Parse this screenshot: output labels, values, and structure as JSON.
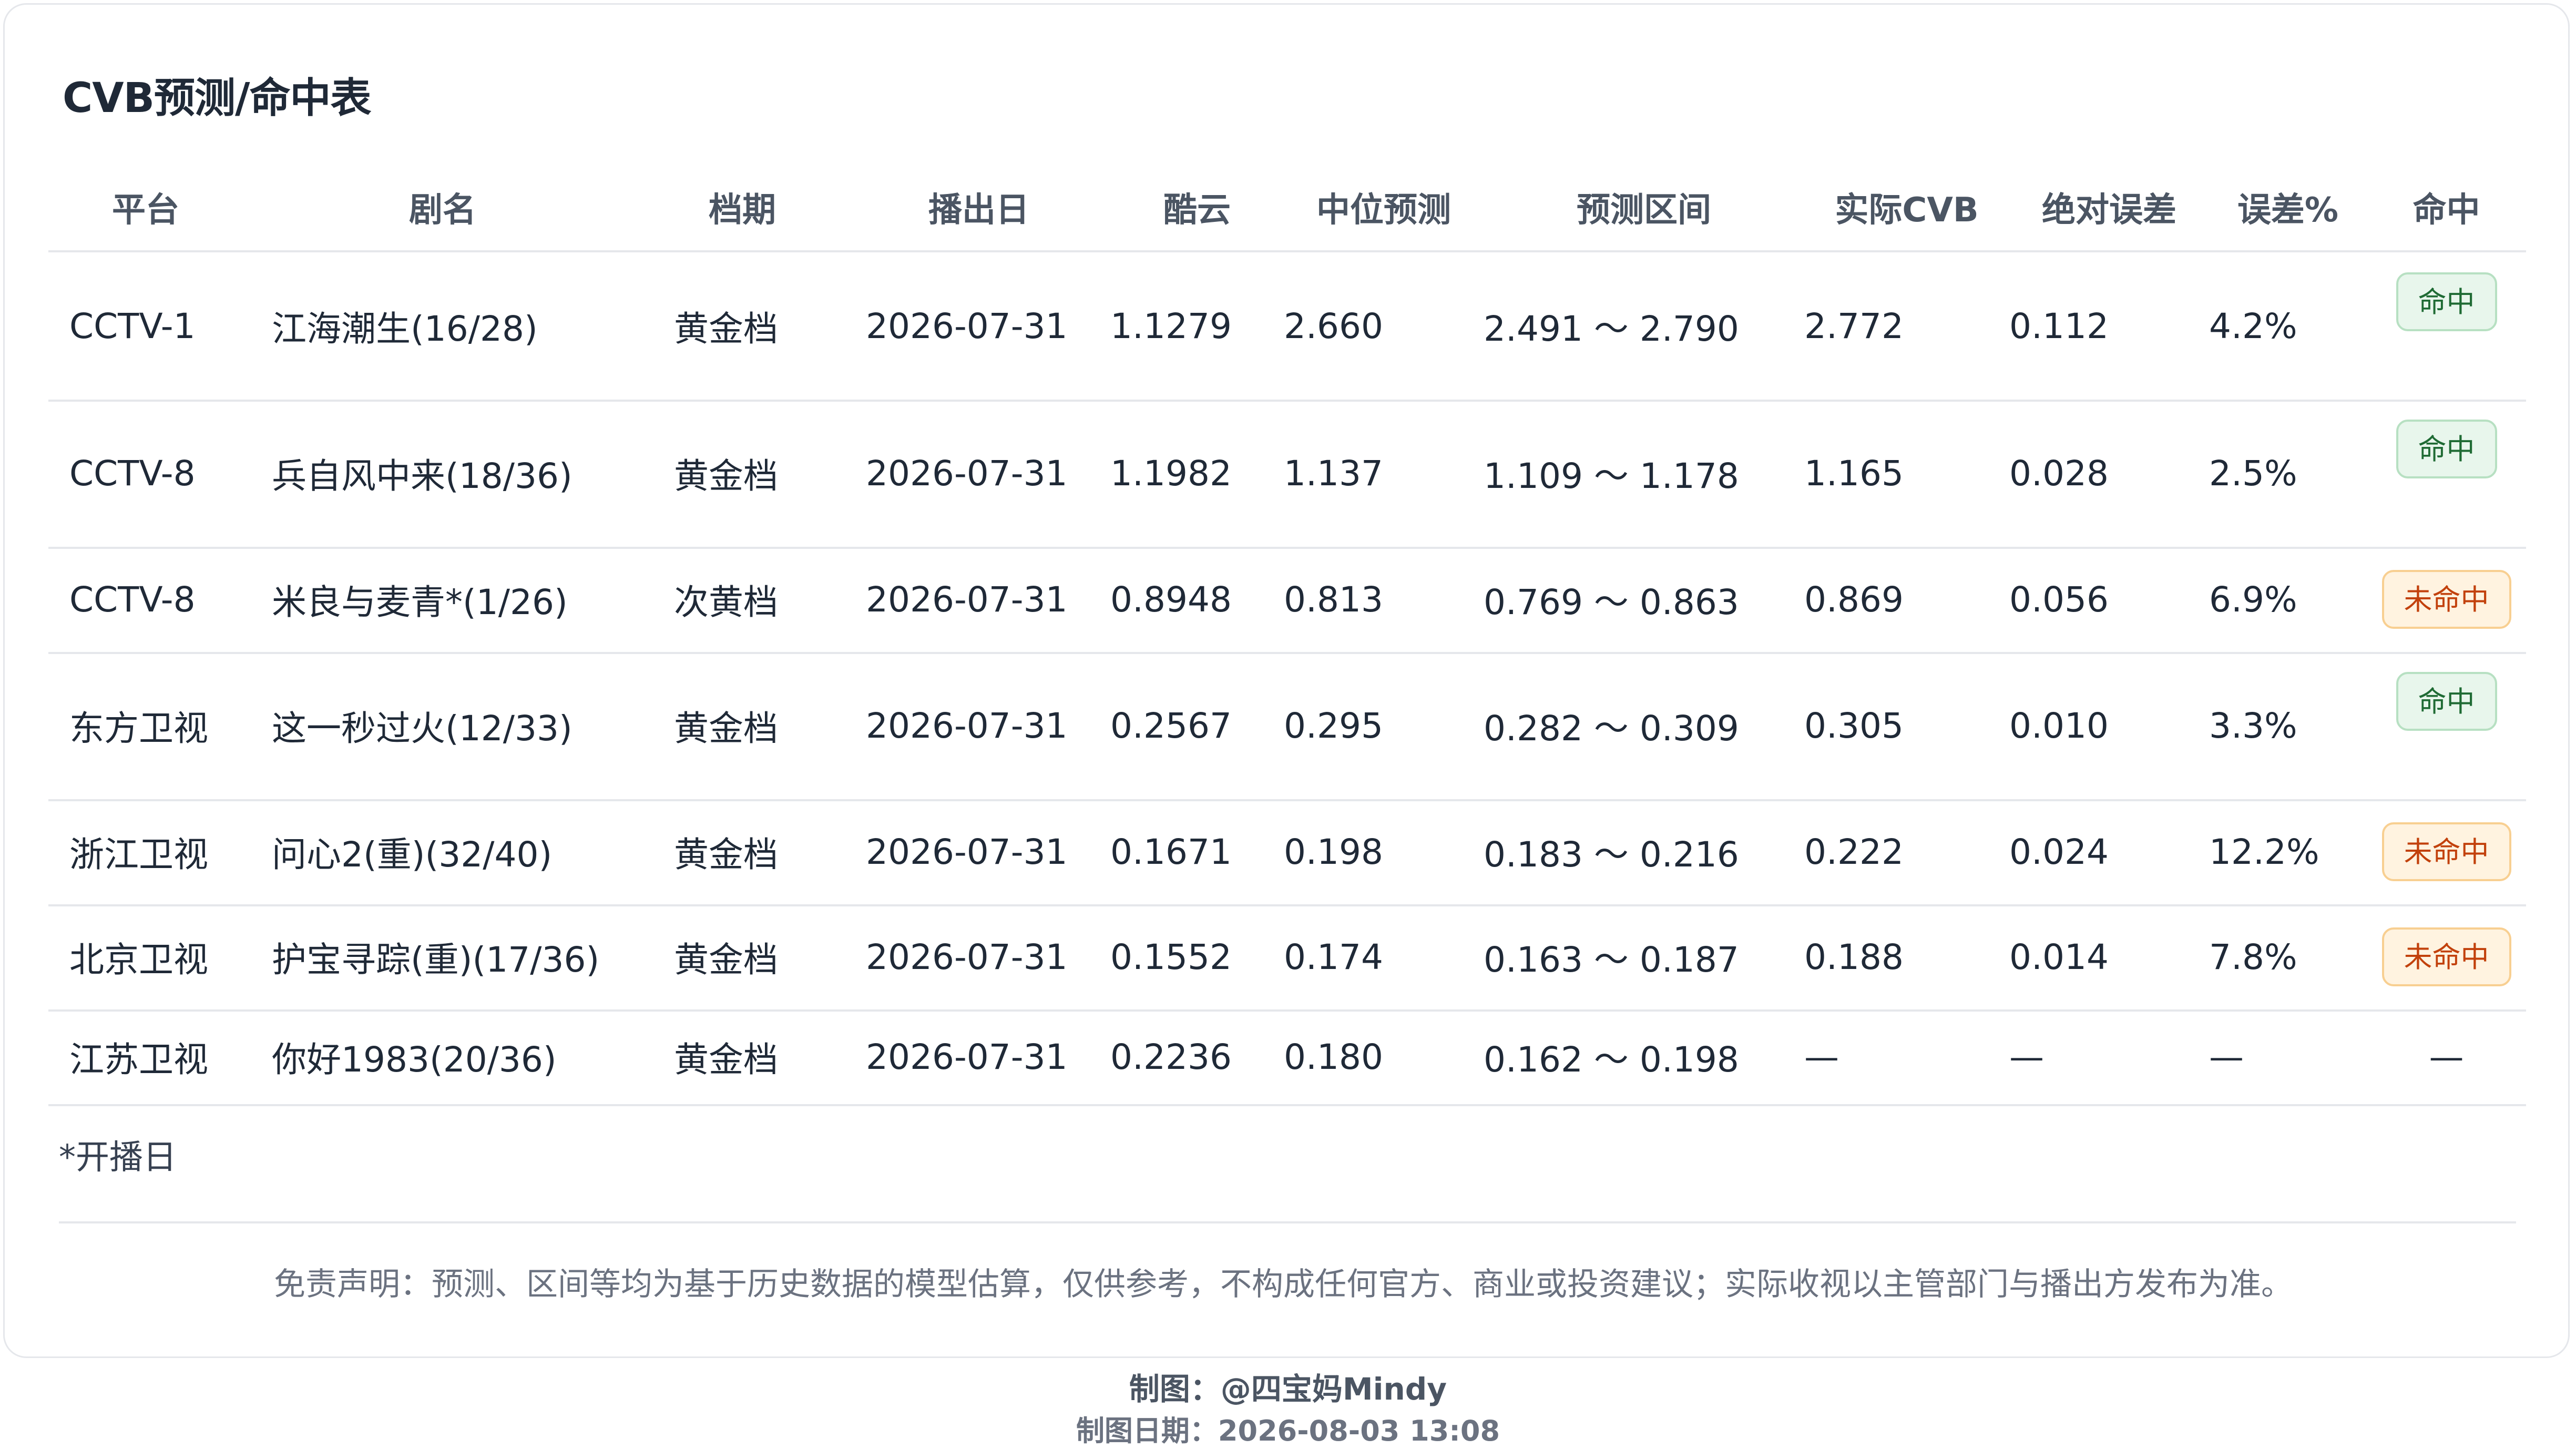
{
  "title": "CVB预测/命中表",
  "columns": [
    "平台",
    "剧名",
    "档期",
    "播出日",
    "酷云",
    "中位预测",
    "预测区间",
    "实际CVB",
    "绝对误差",
    "误差%",
    "命中"
  ],
  "rows": [
    {
      "platform": "CCTV-1",
      "drama": "江海潮生(16/28)",
      "slot": "黄金档",
      "date": "2026-07-31",
      "kuyun": "1.1279",
      "median": "2.660",
      "range": "2.491 ～ 2.790",
      "actual": "2.772",
      "abs_err": "0.112",
      "err_pct": "4.2%",
      "hit": "命中",
      "status": "hit"
    },
    {
      "platform": "CCTV-8",
      "drama": "兵自风中来(18/36)",
      "slot": "黄金档",
      "date": "2026-07-31",
      "kuyun": "1.1982",
      "median": "1.137",
      "range": "1.109 ～ 1.178",
      "actual": "1.165",
      "abs_err": "0.028",
      "err_pct": "2.5%",
      "hit": "命中",
      "status": "hit"
    },
    {
      "platform": "CCTV-8",
      "drama": "米良与麦青*(1/26)",
      "slot": "次黄档",
      "date": "2026-07-31",
      "kuyun": "0.8948",
      "median": "0.813",
      "range": "0.769 ～ 0.863",
      "actual": "0.869",
      "abs_err": "0.056",
      "err_pct": "6.9%",
      "hit": "未命中",
      "status": "miss"
    },
    {
      "platform": "东方卫视",
      "drama": "这一秒过火(12/33)",
      "slot": "黄金档",
      "date": "2026-07-31",
      "kuyun": "0.2567",
      "median": "0.295",
      "range": "0.282 ～ 0.309",
      "actual": "0.305",
      "abs_err": "0.010",
      "err_pct": "3.3%",
      "hit": "命中",
      "status": "hit"
    },
    {
      "platform": "浙江卫视",
      "drama": "问心2(重)(32/40)",
      "slot": "黄金档",
      "date": "2026-07-31",
      "kuyun": "0.1671",
      "median": "0.198",
      "range": "0.183 ～ 0.216",
      "actual": "0.222",
      "abs_err": "0.024",
      "err_pct": "12.2%",
      "hit": "未命中",
      "status": "miss"
    },
    {
      "platform": "北京卫视",
      "drama": "护宝寻踪(重)(17/36)",
      "slot": "黄金档",
      "date": "2026-07-31",
      "kuyun": "0.1552",
      "median": "0.174",
      "range": "0.163 ～ 0.187",
      "actual": "0.188",
      "abs_err": "0.014",
      "err_pct": "7.8%",
      "hit": "未命中",
      "status": "miss"
    },
    {
      "platform": "江苏卫视",
      "drama": "你好1983(20/36)",
      "slot": "黄金档",
      "date": "2026-07-31",
      "kuyun": "0.2236",
      "median": "0.180",
      "range": "0.162 ～ 0.198",
      "actual": "—",
      "abs_err": "—",
      "err_pct": "—",
      "hit": "—",
      "status": "none"
    }
  ],
  "footnote": "*开播日",
  "disclaimer": "免责声明：预测、区间等均为基于历史数据的模型估算，仅供参考，不构成任何官方、商业或投资建议；实际收视以主管部门与播出方发布为准。",
  "credit": "制图：@四宝妈Mindy",
  "credit_date": "制图日期：2026-08-03 13:08",
  "colors": {
    "hit_bg": "#e8f6ec",
    "hit_text": "#1f6b34",
    "miss_bg": "#fff3e0",
    "miss_text": "#c2410c"
  }
}
